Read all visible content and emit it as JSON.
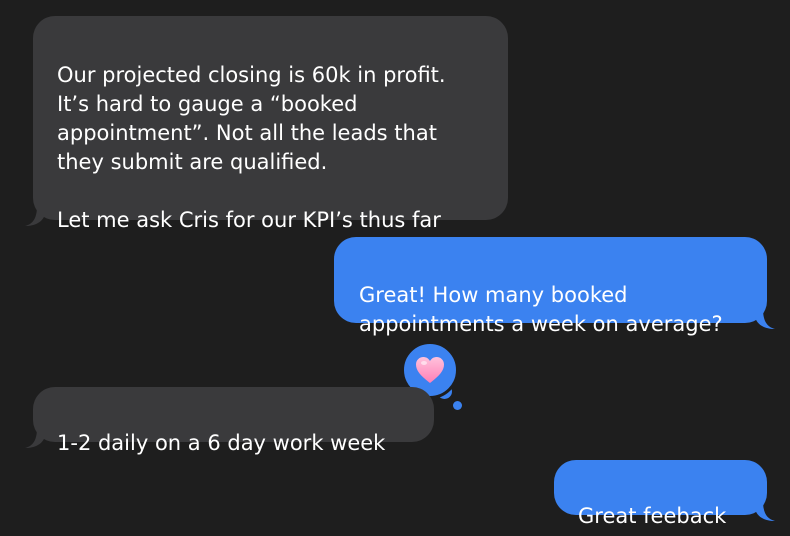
{
  "colors": {
    "background": "#1e1e1e",
    "incoming_bubble": "#3a3a3c",
    "outgoing_bubble": "#3b82f0",
    "text": "#ffffff",
    "heart": "#ff8fbf"
  },
  "messages": [
    {
      "direction": "incoming",
      "text": "Our projected closing is 60k in profit.\nIt’s hard to gauge a “booked\nappointment”. Not all the leads that\nthey submit are qualified.\n\nLet me ask Cris for our KPI’s thus far"
    },
    {
      "direction": "outgoing",
      "text": "Great! How many booked\nappointments a week on average?",
      "reaction": "heart-icon"
    },
    {
      "direction": "incoming",
      "text": "1-2 daily on a 6 day work week"
    },
    {
      "direction": "outgoing",
      "text": "Great feeback"
    }
  ]
}
